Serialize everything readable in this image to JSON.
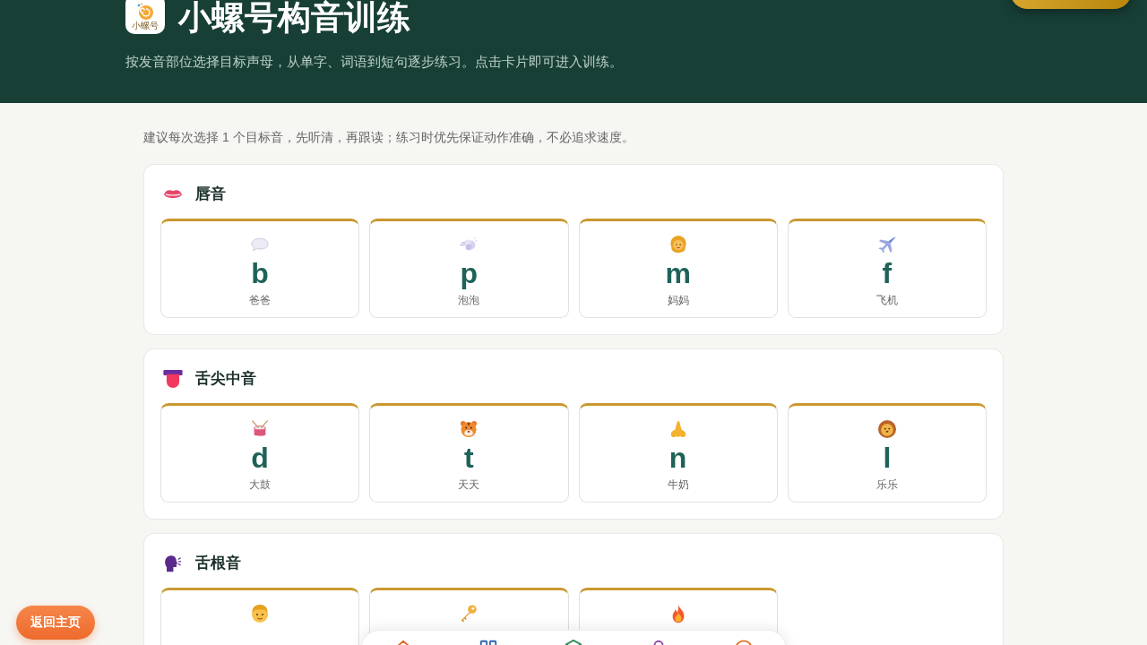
{
  "header": {
    "logo_text": "小螺号",
    "title": "小螺号构音训练",
    "subtitle": "按发音部位选择目标声母，从单字、词语到短句逐步练习。点击卡片即可进入训练。"
  },
  "hint": "建议每次选择 1 个目标音，先听清，再跟读；练习时优先保证动作准确，不必追求速度。",
  "sections": [
    {
      "kind": "lips",
      "title": "唇音",
      "cards": [
        {
          "kind": "speech-bubble",
          "letter": "b",
          "word": "爸爸"
        },
        {
          "kind": "puff",
          "letter": "p",
          "word": "泡泡"
        },
        {
          "kind": "woman",
          "letter": "m",
          "word": "妈妈"
        },
        {
          "kind": "airplane",
          "letter": "f",
          "word": "飞机"
        }
      ]
    },
    {
      "kind": "tongue",
      "title": "舌尖中音",
      "cards": [
        {
          "kind": "drum",
          "letter": "d",
          "word": "大鼓"
        },
        {
          "kind": "tiger",
          "letter": "t",
          "word": "天天"
        },
        {
          "kind": "nose",
          "letter": "n",
          "word": "牛奶"
        },
        {
          "kind": "lion",
          "letter": "l",
          "word": "乐乐"
        }
      ]
    },
    {
      "kind": "speaking-head",
      "title": "舌根音",
      "cards": [
        {
          "kind": "boy"
        },
        {
          "kind": "key"
        },
        {
          "kind": "fire"
        }
      ]
    }
  ],
  "return_button": {
    "label": "返回主页"
  }
}
